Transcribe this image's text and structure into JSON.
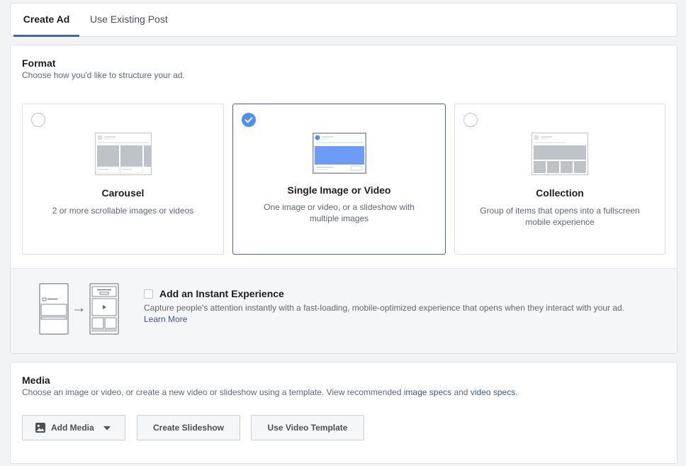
{
  "tabs": {
    "create_ad": "Create Ad",
    "use_existing_post": "Use Existing Post"
  },
  "format": {
    "title": "Format",
    "subtitle": "Choose how you'd like to structure your ad.",
    "selected": "single",
    "cards": {
      "carousel": {
        "title": "Carousel",
        "desc": "2 or more scrollable images or videos"
      },
      "single": {
        "title": "Single Image or Video",
        "desc": "One image or video, or a slideshow with multiple images"
      },
      "collection": {
        "title": "Collection",
        "desc": "Group of items that opens into a fullscreen mobile experience"
      }
    }
  },
  "instant_experience": {
    "title": "Add an Instant Experience",
    "checked": false,
    "desc": "Capture people's attention instantly with a fast-loading, mobile-optimized experience that opens when they interact with your ad.",
    "link": "Learn More"
  },
  "media": {
    "title": "Media",
    "subtitle_prefix": "Choose an image or video, or create a new video or slideshow using a template. View recommended ",
    "image_specs": "image specs",
    "and": " and ",
    "video_specs": "video specs",
    "period": ".",
    "buttons": {
      "add_media": "Add Media",
      "create_slideshow": "Create Slideshow",
      "use_video_template": "Use Video Template"
    }
  },
  "colors": {
    "accent": "#4267b2",
    "check": "#4b8ff8",
    "link": "#365899"
  }
}
